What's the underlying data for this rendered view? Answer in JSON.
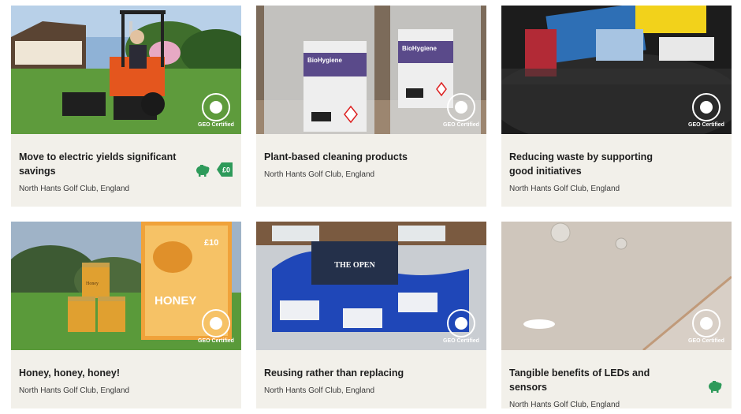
{
  "badge_label": "GEO Certified",
  "icons": {
    "savings": "piggy-bank-icon",
    "zero": "zero-carbon-tag-icon"
  },
  "colors": {
    "card_bg": "#f2f0ea",
    "icon_green": "#2e9a5a"
  },
  "cards": [
    {
      "title": "Move to electric yields significant savings",
      "location": "North Hants Golf Club, England",
      "zero_icon_text": "£0"
    },
    {
      "title": "Plant-based cleaning products",
      "location": "North Hants Golf Club, England",
      "bottle1_brand": "BioHygiene",
      "bottle2_brand": "BioHygiene"
    },
    {
      "title": "Reducing waste by supporting good initiatives",
      "location": "North Hants Golf Club, England"
    },
    {
      "title": "Honey, honey, honey!",
      "location": "North Hants Golf Club, England",
      "sign_price": "£10",
      "sign_text": "HONEY",
      "jar_label": "Honey"
    },
    {
      "title": "Reusing rather than replacing",
      "location": "North Hants Golf Club, England",
      "bag_text": "THE OPEN"
    },
    {
      "title": "Tangible benefits of LEDs and sensors",
      "location": "North Hants Golf Club, England"
    }
  ]
}
